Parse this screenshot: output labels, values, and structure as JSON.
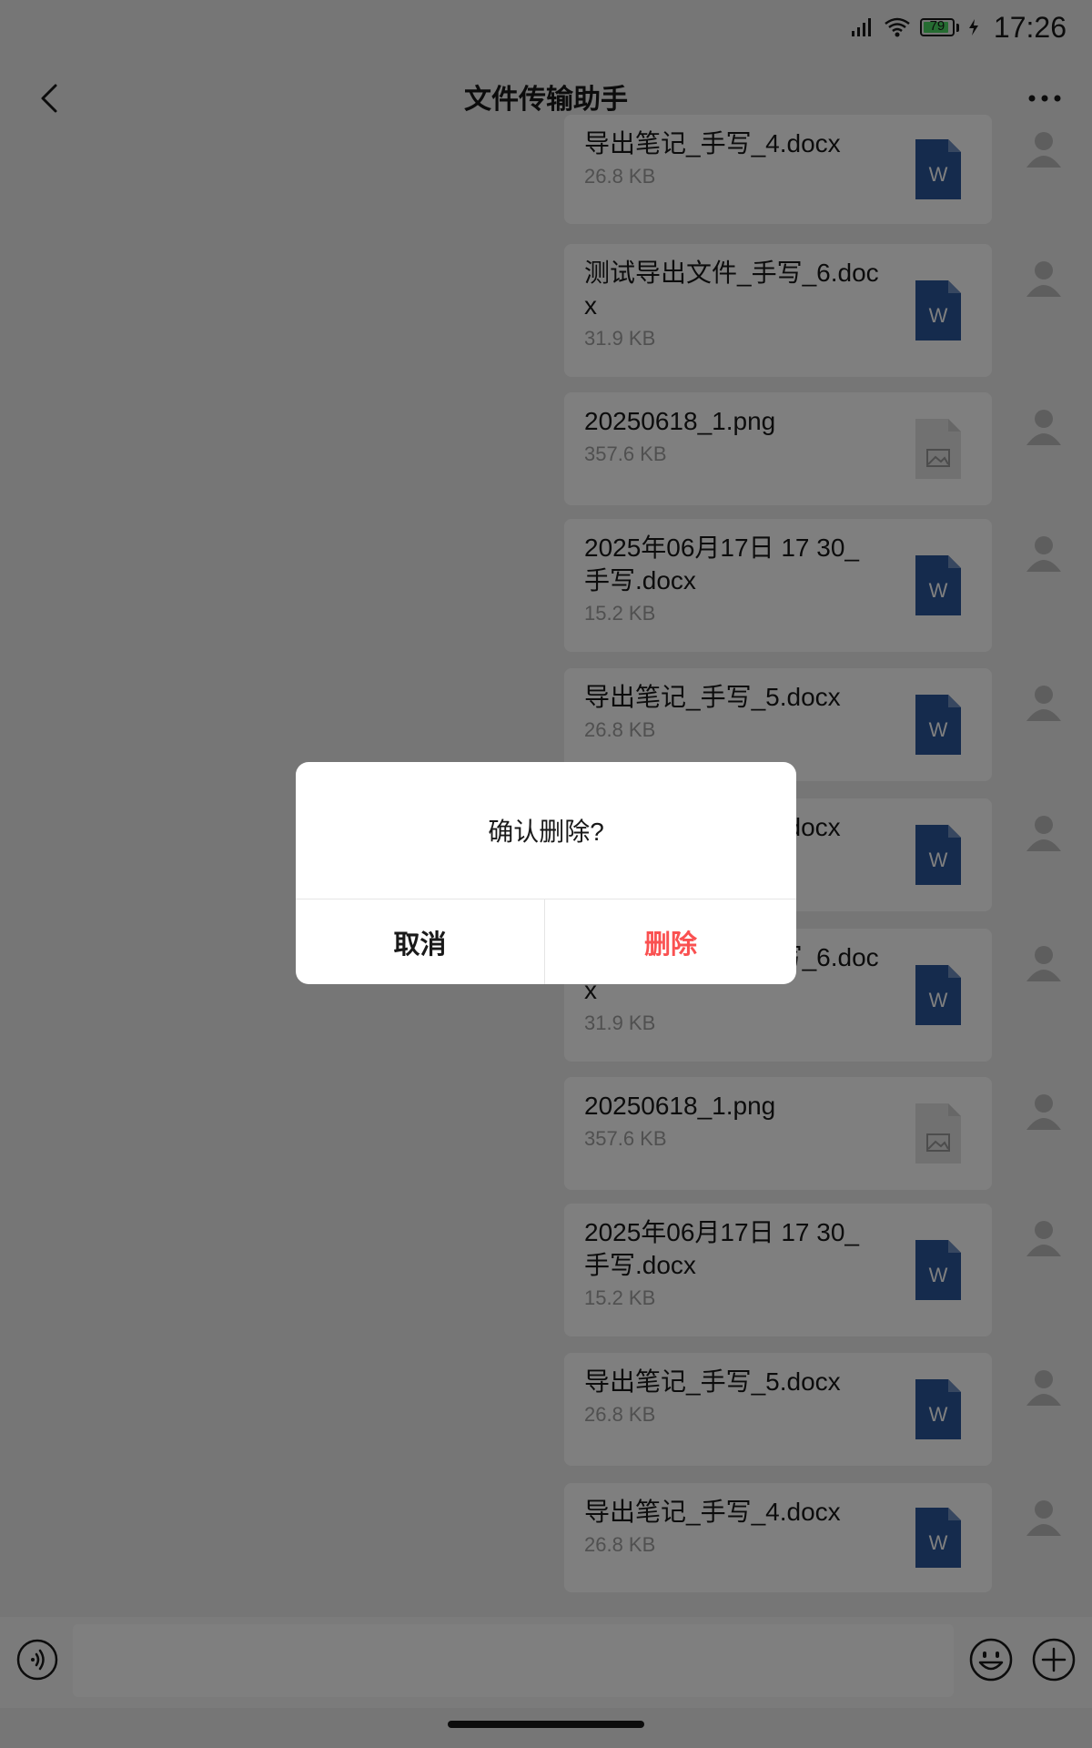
{
  "status_bar": {
    "time": "17:26",
    "battery": "79",
    "icons": [
      "signal-icon",
      "wifi-icon",
      "battery-icon",
      "charging-icon"
    ]
  },
  "nav": {
    "title": "文件传输助手",
    "back_icon": "chevron-left-icon",
    "more_icon": "more-icon"
  },
  "messages": [
    {
      "name": "导出笔记_手写_4.docx",
      "size": "26.8 KB",
      "type": "word"
    },
    {
      "name": "测试导出文件_手写_6.docx",
      "size": "31.9 KB",
      "type": "word"
    },
    {
      "name": "20250618_1.png",
      "size": "357.6 KB",
      "type": "image"
    },
    {
      "name": "2025年06月17日 17 30_手写.docx",
      "size": "15.2 KB",
      "type": "word"
    },
    {
      "name": "导出笔记_手写_5.docx",
      "size": "26.8 KB",
      "type": "word"
    },
    {
      "name": "导出笔记_手写_4.docx",
      "size": "26.8 KB",
      "type": "word"
    },
    {
      "name": "测试导出文件_手写_6.docx",
      "size": "31.9 KB",
      "type": "word"
    },
    {
      "name": "20250618_1.png",
      "size": "357.6 KB",
      "type": "image"
    },
    {
      "name": "2025年06月17日 17 30_手写.docx",
      "size": "15.2 KB",
      "type": "word"
    },
    {
      "name": "导出笔记_手写_5.docx",
      "size": "26.8 KB",
      "type": "word"
    },
    {
      "name": "导出笔记_手写_4.docx",
      "size": "26.8 KB",
      "type": "word"
    }
  ],
  "word_icon_letter": "W",
  "input_bar": {
    "voice_icon": "voice-icon",
    "emoji_icon": "emoji-icon",
    "plus_icon": "plus-icon"
  },
  "dialog": {
    "message": "确认删除?",
    "cancel_label": "取消",
    "confirm_label": "删除"
  },
  "colors": {
    "danger": "#fa5151",
    "word_blue": "#2b579a",
    "card_bg": "#ffffff",
    "page_bg": "#ededed"
  }
}
